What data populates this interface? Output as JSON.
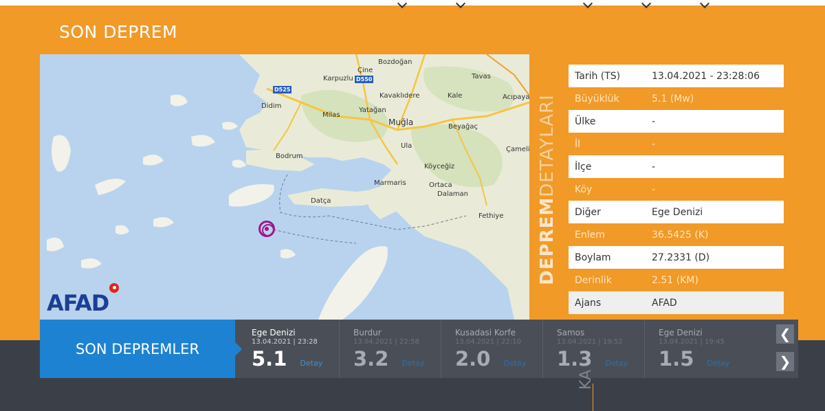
{
  "section_title": "SON DEPREM",
  "map": {
    "logo_text": "AFAD",
    "labels": [
      {
        "text": "Bozdoğan"
      },
      {
        "text": "Çine"
      },
      {
        "text": "Karpuzlu"
      },
      {
        "text": "Tavas"
      },
      {
        "text": "Didim"
      },
      {
        "text": "Kavaklıdere"
      },
      {
        "text": "Kale"
      },
      {
        "text": "Acıpayam"
      },
      {
        "text": "Milas"
      },
      {
        "text": "Yatağan"
      },
      {
        "text": "Muğla"
      },
      {
        "text": "Beyağaç"
      },
      {
        "text": "Ula"
      },
      {
        "text": "Çameli"
      },
      {
        "text": "Bodrum"
      },
      {
        "text": "Köyceğiz"
      },
      {
        "text": "Marmaris"
      },
      {
        "text": "Ortaca"
      },
      {
        "text": "Dalaman"
      },
      {
        "text": "Datça"
      },
      {
        "text": "Fethiye"
      }
    ],
    "road_badges": [
      "D525",
      "D550"
    ]
  },
  "details_label": {
    "bold": "DEPREM",
    "light": "DETAYLARI"
  },
  "details": [
    {
      "key": "Tarih (TS)",
      "value": "13.04.2021 - 23:28:06"
    },
    {
      "key": "Büyüklük",
      "value": "5.1 (Mw)"
    },
    {
      "key": "Ülke",
      "value": "-"
    },
    {
      "key": "İl",
      "value": "-"
    },
    {
      "key": "İlçe",
      "value": "-"
    },
    {
      "key": "Köy",
      "value": "-"
    },
    {
      "key": "Diğer",
      "value": "Ege Denizi"
    },
    {
      "key": "Enlem",
      "value": "36.5425 (K)"
    },
    {
      "key": "Boylam",
      "value": "27.2331 (D)"
    },
    {
      "key": "Derinlik",
      "value": "2.51 (KM)"
    },
    {
      "key": "Ajans",
      "value": "AFAD"
    }
  ],
  "recent": {
    "title": "SON DEPREMLER",
    "detail_label": "Detay",
    "items": [
      {
        "location": "Ege Denizi",
        "time": "13.04.2021 | 23:28",
        "magnitude": "5.1"
      },
      {
        "location": "Burdur",
        "time": "13.04.2021 | 22:58",
        "magnitude": "3.2"
      },
      {
        "location": "Kusadasi Korfe",
        "time": "13.04.2021 | 22:10",
        "magnitude": "2.0"
      },
      {
        "location": "Samos",
        "time": "13.04.2021 | 19:52",
        "magnitude": "1.3"
      },
      {
        "location": "Ege Denizi",
        "time": "13.04.2021 | 19:45",
        "magnitude": "1.5"
      }
    ],
    "prev_icon": "chevron-left-icon",
    "next_icon": "chevron-right-icon"
  },
  "bottom_partial_text": "KA"
}
